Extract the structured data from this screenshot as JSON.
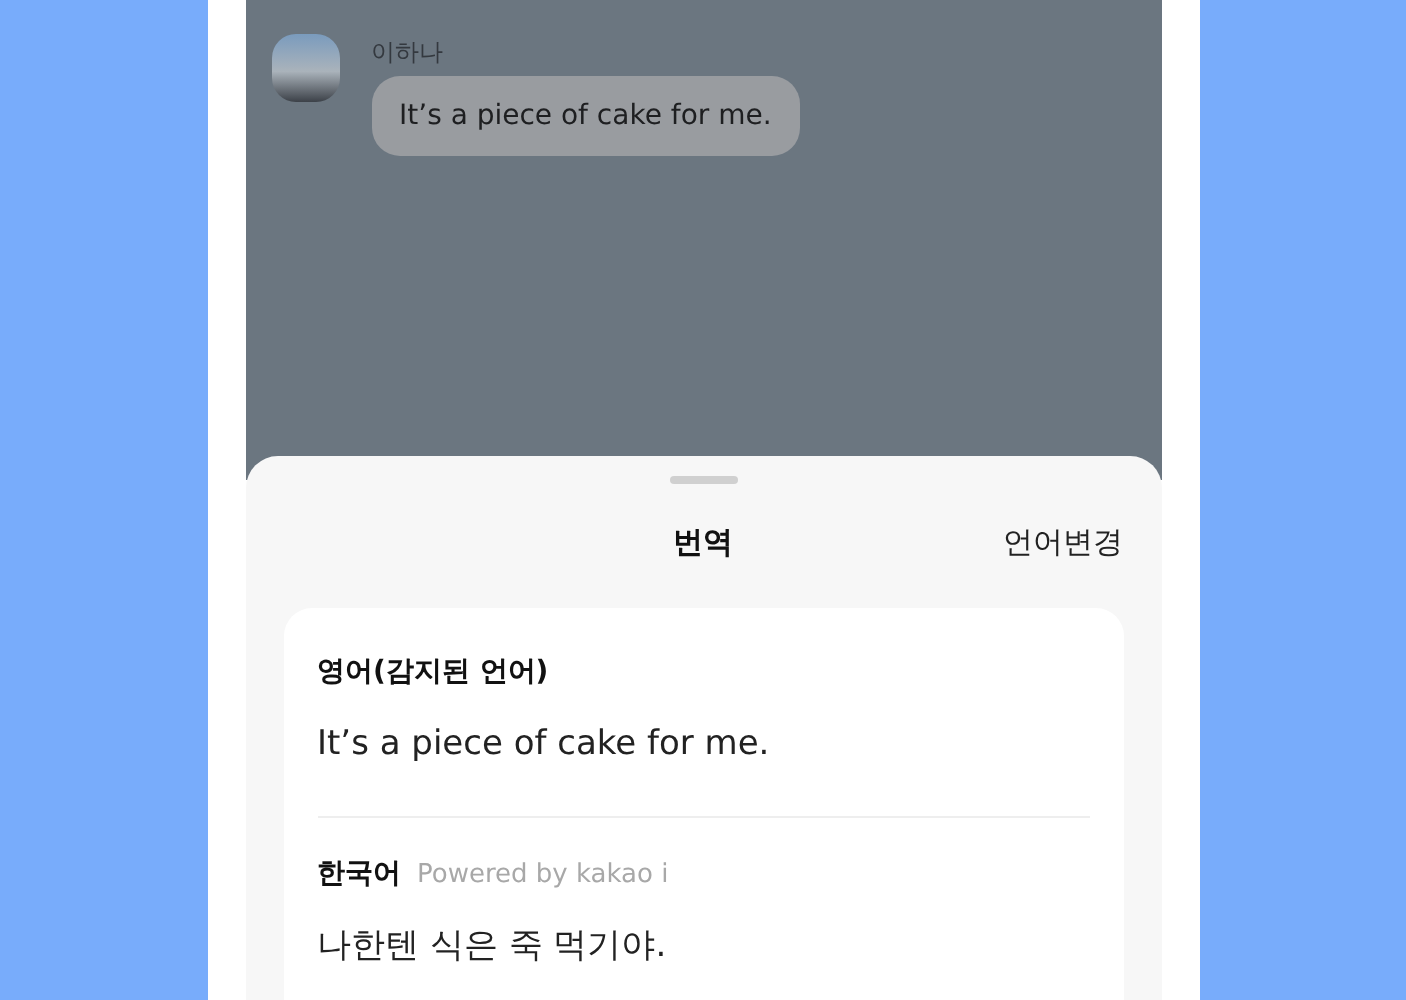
{
  "chat": {
    "message": {
      "sender": "이하나",
      "text": "It’s a piece of cake for me."
    }
  },
  "sheet": {
    "title": "번역",
    "action": "언어변경",
    "source": {
      "label": "영어(감지된 언어)",
      "text": "It’s a piece of cake for me."
    },
    "target": {
      "label": "한국어",
      "credit": "Powered by kakao i",
      "text": "나한텐 식은 죽 먹기야."
    }
  }
}
